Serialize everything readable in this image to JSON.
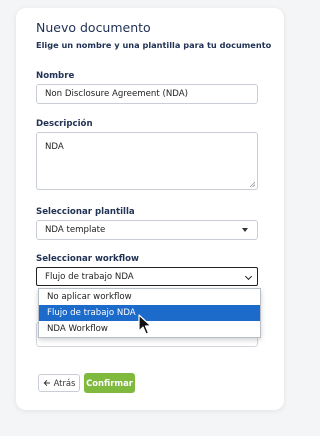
{
  "form": {
    "title": "Nuevo documento",
    "subtitle": "Elige un nombre y una plantilla para tu documento",
    "name_label": "Nombre",
    "name_value": "Non Disclosure Agreement (NDA)",
    "description_label": "Descripción",
    "description_value": "NDA",
    "template_label": "Seleccionar plantilla",
    "template_value": "NDA template",
    "workflow_label": "Seleccionar workflow",
    "workflow_value": "Flujo de trabajo NDA",
    "workflow_options": [
      "No aplicar workflow",
      "Flujo de trabajo NDA",
      "NDA Workflow"
    ],
    "workflow_highlighted": "Flujo de trabajo NDA"
  },
  "buttons": {
    "back_label": "Atrás",
    "confirm_label": "Confirmar"
  },
  "colors": {
    "accent_green": "#7fb93e",
    "highlight_blue": "#1c6ac9",
    "text_navy": "#223355"
  },
  "icons": {
    "back": "arrow-left-icon",
    "select": "caret-down-icon",
    "cursor": "mouse-pointer-icon"
  }
}
